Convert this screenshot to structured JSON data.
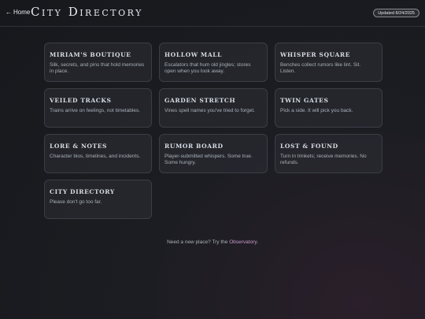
{
  "header": {
    "home_label": "Home",
    "title": "City Directory",
    "updated": "Updated 8/24/2025"
  },
  "cards": [
    {
      "title": "Miriam's Boutique",
      "desc": "Silk, secrets, and pins that hold memories in place."
    },
    {
      "title": "Hollow Mall",
      "desc": "Escalators that hum old jingles; stores open when you look away."
    },
    {
      "title": "Whisper Square",
      "desc": "Benches collect rumors like lint. Sit. Listen."
    },
    {
      "title": "Veiled Tracks",
      "desc": "Trains arrive on feelings, not timetables."
    },
    {
      "title": "Garden Stretch",
      "desc": "Vines spell names you've tried to forget."
    },
    {
      "title": "Twin Gates",
      "desc": "Pick a side. It will pick you back."
    },
    {
      "title": "Lore & Notes",
      "desc": "Character bios, timelines, and incidents."
    },
    {
      "title": "Rumor Board",
      "desc": "Player-submitted whispers. Some true. Some hungry."
    },
    {
      "title": "Lost & Found",
      "desc": "Turn in trinkets; receive memories. No refunds."
    },
    {
      "title": "City Directory",
      "desc": "Please don't go too far."
    }
  ],
  "footer": {
    "text": "Need a new place? Try the",
    "link": "Observatory",
    "end": "."
  }
}
